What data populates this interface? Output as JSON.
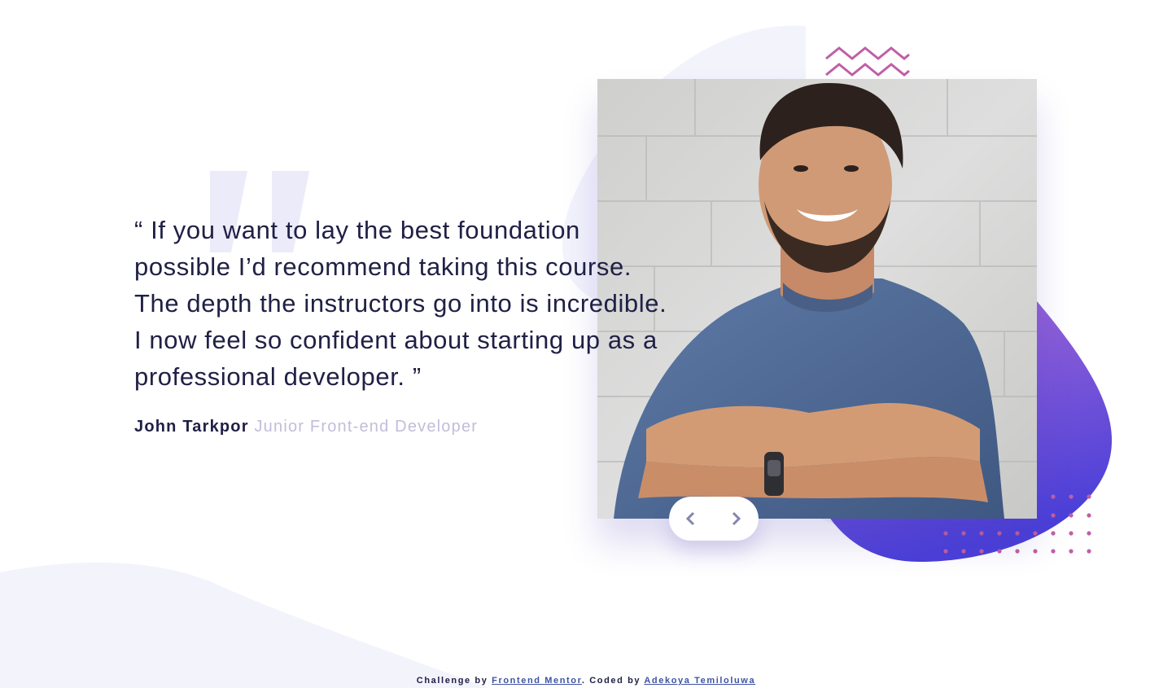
{
  "testimonial": {
    "quote": "“ If you want to lay the best foundation possible I’d recommend taking this course. The depth the instructors go into is incredible. I now feel so confident about starting up as a professional developer. ”",
    "author_name": "John Tarkpor",
    "author_role": "Junior Front-end Developer"
  },
  "icons": {
    "quote_mark": "quote-mark-icon",
    "previous": "chevron-left-icon",
    "next": "chevron-right-icon",
    "zigzag": "zigzag-pattern-icon",
    "dots": "dot-grid-pattern-icon"
  },
  "attribution": {
    "prefix": "Challenge by ",
    "frontend_mentor": "Frontend Mentor",
    "middle": ". Coded by ",
    "coder": "Adekoya Temiloluwa"
  },
  "colors": {
    "text_dark": "#202046",
    "text_muted": "#c0bedb",
    "blob_light": "#f3f3fc",
    "blob_gradient_top": "#a66ad8",
    "blob_gradient_bottom": "#4a3fd8",
    "accent_pink": "#c05fa6",
    "link": "#3e52a3"
  }
}
